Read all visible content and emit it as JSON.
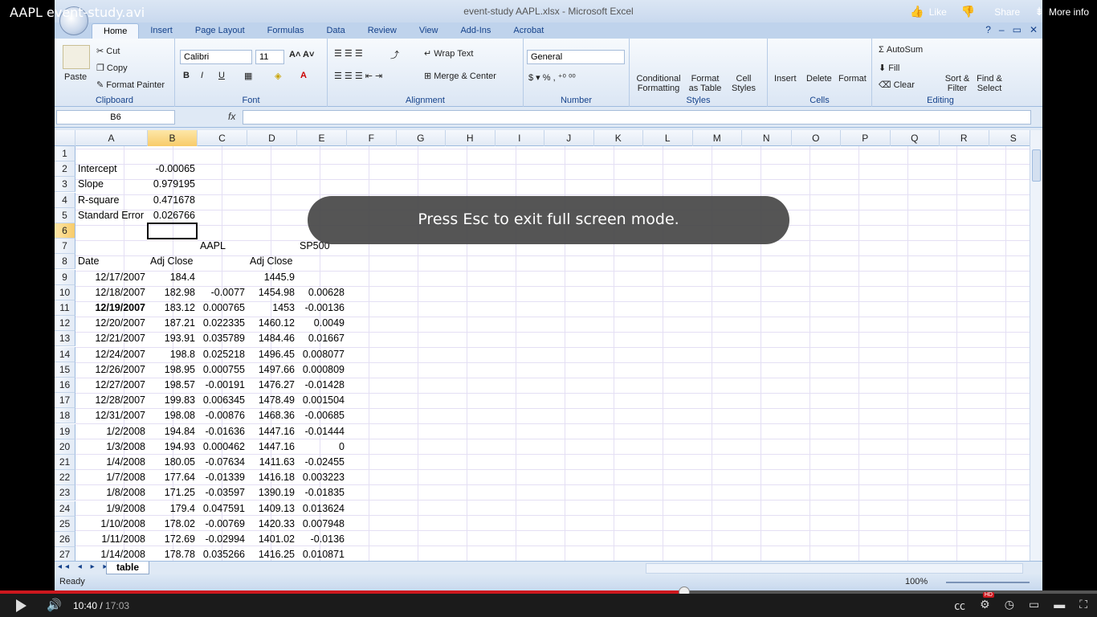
{
  "video": {
    "title": "AAPL event-study.avi",
    "actions": {
      "like": "Like",
      "share": "Share",
      "more": "More info"
    },
    "current_time": "10:40",
    "duration": "17:03",
    "progress": 0.624,
    "esc_message": "Press Esc to exit full screen mode.",
    "hd": "HD"
  },
  "excel": {
    "window_title": "event-study AAPL.xlsx - Microsoft Excel",
    "tabs": [
      "Home",
      "Insert",
      "Page Layout",
      "Formulas",
      "Data",
      "Review",
      "View",
      "Add-Ins",
      "Acrobat"
    ],
    "ribbon": {
      "clipboard": {
        "label": "Clipboard",
        "paste": "Paste",
        "cut": "Cut",
        "copy": "Copy",
        "format_painter": "Format Painter"
      },
      "font": {
        "label": "Font",
        "font_name": "Calibri",
        "font_size": "11"
      },
      "alignment": {
        "label": "Alignment",
        "wrap": "Wrap Text",
        "merge": "Merge & Center"
      },
      "number": {
        "label": "Number",
        "format": "General"
      },
      "styles": {
        "label": "Styles",
        "conditional": "Conditional Formatting",
        "format_table": "Format as Table",
        "cell_styles": "Cell Styles"
      },
      "cells": {
        "label": "Cells",
        "insert": "Insert",
        "delete": "Delete",
        "format": "Format"
      },
      "editing": {
        "label": "Editing",
        "autosum": "AutoSum",
        "fill": "Fill",
        "clear": "Clear",
        "sort": "Sort & Filter",
        "find": "Find & Select"
      }
    },
    "name_box": "B6",
    "fx": "fx",
    "columns": [
      "A",
      "B",
      "C",
      "D",
      "E",
      "F",
      "G",
      "H",
      "I",
      "J",
      "K",
      "L",
      "M",
      "N",
      "O",
      "P",
      "Q",
      "R",
      "S"
    ],
    "selected_col": "B",
    "selected_row": "6",
    "rows": [
      {
        "n": "1",
        "a": "",
        "b": "",
        "c": "",
        "d": "",
        "e": ""
      },
      {
        "n": "2",
        "a": "Intercept",
        "b": "-0.00065",
        "c": "",
        "d": "",
        "e": ""
      },
      {
        "n": "3",
        "a": "Slope",
        "b": "0.979195",
        "c": "",
        "d": "",
        "e": ""
      },
      {
        "n": "4",
        "a": "R-square",
        "b": "0.471678",
        "c": "",
        "d": "",
        "e": ""
      },
      {
        "n": "5",
        "a": "Standard Error",
        "b": "0.026766",
        "c": "",
        "d": "",
        "e": ""
      },
      {
        "n": "6",
        "a": "",
        "b": "",
        "c": "",
        "d": "",
        "e": ""
      },
      {
        "n": "7",
        "a": "",
        "b": "",
        "c": "AAPL",
        "d": "",
        "e": "SP500"
      },
      {
        "n": "8",
        "a": "Date",
        "b": "Adj Close",
        "c": "",
        "d": "Adj Close",
        "e": ""
      },
      {
        "n": "9",
        "a": "12/17/2007",
        "b": "184.4",
        "c": "",
        "d": "1445.9",
        "e": ""
      },
      {
        "n": "10",
        "a": "12/18/2007",
        "b": "182.98",
        "c": "-0.0077",
        "d": "1454.98",
        "e": "0.00628"
      },
      {
        "n": "11",
        "a": "12/19/2007",
        "b": "183.12",
        "c": "0.000765",
        "d": "1453",
        "e": "-0.00136"
      },
      {
        "n": "12",
        "a": "12/20/2007",
        "b": "187.21",
        "c": "0.022335",
        "d": "1460.12",
        "e": "0.0049"
      },
      {
        "n": "13",
        "a": "12/21/2007",
        "b": "193.91",
        "c": "0.035789",
        "d": "1484.46",
        "e": "0.01667"
      },
      {
        "n": "14",
        "a": "12/24/2007",
        "b": "198.8",
        "c": "0.025218",
        "d": "1496.45",
        "e": "0.008077"
      },
      {
        "n": "15",
        "a": "12/26/2007",
        "b": "198.95",
        "c": "0.000755",
        "d": "1497.66",
        "e": "0.000809"
      },
      {
        "n": "16",
        "a": "12/27/2007",
        "b": "198.57",
        "c": "-0.00191",
        "d": "1476.27",
        "e": "-0.01428"
      },
      {
        "n": "17",
        "a": "12/28/2007",
        "b": "199.83",
        "c": "0.006345",
        "d": "1478.49",
        "e": "0.001504"
      },
      {
        "n": "18",
        "a": "12/31/2007",
        "b": "198.08",
        "c": "-0.00876",
        "d": "1468.36",
        "e": "-0.00685"
      },
      {
        "n": "19",
        "a": "1/2/2008",
        "b": "194.84",
        "c": "-0.01636",
        "d": "1447.16",
        "e": "-0.01444"
      },
      {
        "n": "20",
        "a": "1/3/2008",
        "b": "194.93",
        "c": "0.000462",
        "d": "1447.16",
        "e": "0"
      },
      {
        "n": "21",
        "a": "1/4/2008",
        "b": "180.05",
        "c": "-0.07634",
        "d": "1411.63",
        "e": "-0.02455"
      },
      {
        "n": "22",
        "a": "1/7/2008",
        "b": "177.64",
        "c": "-0.01339",
        "d": "1416.18",
        "e": "0.003223"
      },
      {
        "n": "23",
        "a": "1/8/2008",
        "b": "171.25",
        "c": "-0.03597",
        "d": "1390.19",
        "e": "-0.01835"
      },
      {
        "n": "24",
        "a": "1/9/2008",
        "b": "179.4",
        "c": "0.047591",
        "d": "1409.13",
        "e": "0.013624"
      },
      {
        "n": "25",
        "a": "1/10/2008",
        "b": "178.02",
        "c": "-0.00769",
        "d": "1420.33",
        "e": "0.007948"
      },
      {
        "n": "26",
        "a": "1/11/2008",
        "b": "172.69",
        "c": "-0.02994",
        "d": "1401.02",
        "e": "-0.0136"
      },
      {
        "n": "27",
        "a": "1/14/2008",
        "b": "178.78",
        "c": "0.035266",
        "d": "1416.25",
        "e": "0.010871"
      }
    ],
    "sheet_tab": "table",
    "status": "Ready",
    "zoom": "100%"
  }
}
